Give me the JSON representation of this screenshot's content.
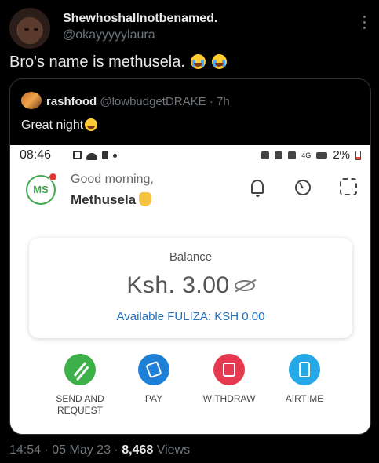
{
  "tweet": {
    "display_name": "Shewhoshallnotbenamed.",
    "handle": "@okayyyyylaura",
    "text": "Bro's name is methusela.",
    "emojis": [
      "loudly-crying-face",
      "loudly-crying-face"
    ],
    "more_icon": "more-options-icon"
  },
  "quote": {
    "author": "rashfood",
    "handle": "@lowbudgetDRAKE",
    "time": "· 7h",
    "text": "Great night",
    "emoji": "worried-face"
  },
  "phone": {
    "status_time": "08:46",
    "status_battery": "2%",
    "status_network": "4G",
    "avatar_initials": "MS",
    "greeting": "Good morning,",
    "user_name": "Methusela",
    "header_icons": [
      "bell-icon",
      "pie-chart-icon",
      "qr-scan-icon"
    ],
    "balance_label": "Balance",
    "balance_amount": "Ksh. 3.00",
    "fuliza": "Available FULIZA: KSH 0.00",
    "actions": [
      {
        "label": "SEND AND REQUEST",
        "icon": "send-request-icon",
        "color": "#3eb049"
      },
      {
        "label": "PAY",
        "icon": "pay-icon",
        "color": "#1d7fd6"
      },
      {
        "label": "WITHDRAW",
        "icon": "withdraw-icon",
        "color": "#e53950"
      },
      {
        "label": "AIRTIME",
        "icon": "phone-icon",
        "color": "#24a8e6"
      }
    ]
  },
  "meta": {
    "time": "14:54",
    "date": "05 May 23",
    "views_count": "8,468",
    "views_label": "Views"
  }
}
